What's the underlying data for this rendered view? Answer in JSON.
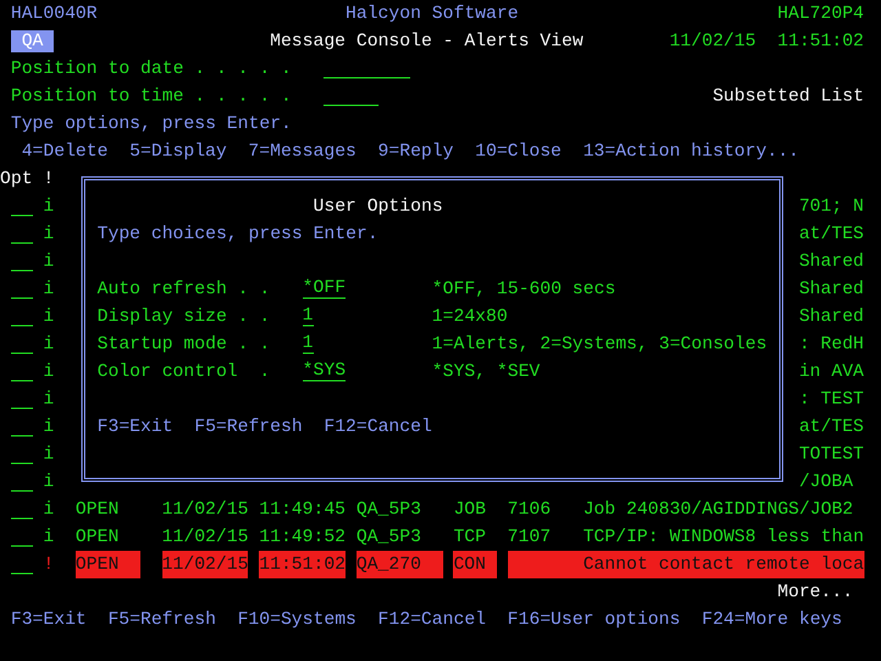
{
  "header": {
    "program": "HAL0040R",
    "product": "Halcyon Software",
    "system": "HAL720P4"
  },
  "title_bar": {
    "environment": "QA",
    "title": "Message Console - Alerts View",
    "date": "11/02/15",
    "time": "11:51:02"
  },
  "position_fields": [
    {
      "kind": "date",
      "label": "Position to date . . . . ."
    },
    {
      "kind": "time",
      "label": "Position to time . . . . ."
    }
  ],
  "list_status": "Subsetted List",
  "instruction": "Type options, press Enter.",
  "options": [
    "4=Delete",
    "5=Display",
    "7=Messages",
    "9=Reply",
    "10=Close",
    "13=Action history..."
  ],
  "list_headings": [
    "Opt",
    "!"
  ],
  "alerts": [
    {
      "kind": "covered",
      "severity": "i",
      "message": "701; N"
    },
    {
      "kind": "covered",
      "severity": "i",
      "message": "at/TES"
    },
    {
      "kind": "covered",
      "severity": "i",
      "message": "Shared"
    },
    {
      "kind": "covered",
      "severity": "i",
      "message": "Shared"
    },
    {
      "kind": "covered",
      "severity": "i",
      "message": "Shared"
    },
    {
      "kind": "covered",
      "severity": "i",
      "message": ": RedH"
    },
    {
      "kind": "covered",
      "severity": "i",
      "message": "in AVA"
    },
    {
      "kind": "covered",
      "severity": "i",
      "message": ": TEST"
    },
    {
      "kind": "covered",
      "severity": "i",
      "message": "at/TES"
    },
    {
      "kind": "covered",
      "severity": "i",
      "message": "TOTEST"
    },
    {
      "kind": "covered",
      "severity": "i",
      "message": "/JOBA"
    },
    {
      "kind": "full",
      "severity": "i",
      "critical": false,
      "status": "OPEN",
      "date": "11/02/15",
      "time": "11:49:45",
      "system": "QA_5P3",
      "type": "JOB",
      "code": "7106",
      "message": "Job 240830/AGIDDINGS/JOB2"
    },
    {
      "kind": "full",
      "severity": "i",
      "critical": false,
      "status": "OPEN",
      "date": "11/02/15",
      "time": "11:49:52",
      "system": "QA_5P3",
      "type": "TCP",
      "code": "7107",
      "message": "TCP/IP: WINDOWS8 less than"
    },
    {
      "kind": "full",
      "severity": "!",
      "critical": true,
      "status": "OPEN",
      "date": "11/02/15",
      "time": "11:51:02",
      "system": "QA_270",
      "type": "CON",
      "message": "Cannot contact remote loca"
    }
  ],
  "more": "More...",
  "function_keys": [
    "F3=Exit",
    "F5=Refresh",
    "F10=Systems",
    "F12=Cancel",
    "F16=User options",
    "F24=More keys"
  ],
  "popup": {
    "title": "User Options",
    "instruction": "Type choices, press Enter.",
    "settings": [
      {
        "label": "Auto refresh . .",
        "value": "*OFF",
        "hint": "*OFF, 15-600 secs"
      },
      {
        "label": "Display size . .",
        "value": "1",
        "hint": "1=24x80"
      },
      {
        "label": "Startup mode . .",
        "value": "1",
        "hint": "1=Alerts, 2=Systems, 3=Consoles"
      },
      {
        "label": "Color control  .",
        "value": "*SYS",
        "hint": "*SYS, *SEV"
      }
    ],
    "function_keys": [
      "F3=Exit",
      "F5=Refresh",
      "F12=Cancel"
    ]
  }
}
